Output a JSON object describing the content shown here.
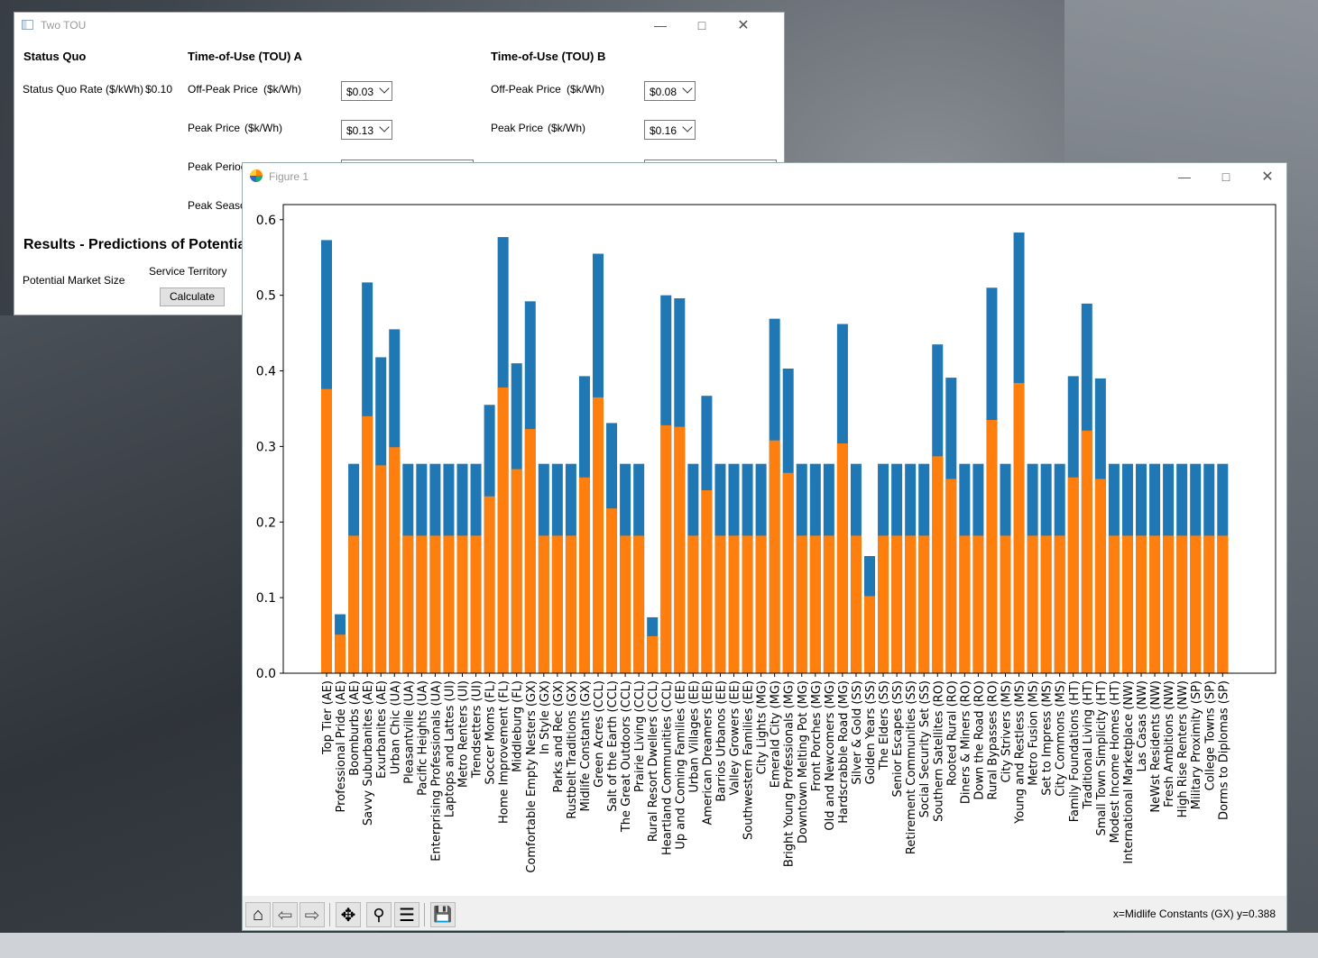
{
  "tou_window": {
    "title": "Two TOU",
    "status_quo_header": "Status Quo",
    "status_quo_rate_label": "Status Quo Rate ($/kWh)",
    "status_quo_rate_value": "$0.10",
    "tou_a_header": "Time-of-Use (TOU) A",
    "tou_b_header": "Time-of-Use (TOU) B",
    "offpeak_label": "Off-Peak Price",
    "peak_label": "Peak Price",
    "unit_label": "($k/Wh)",
    "peak_period_label": "Peak Period",
    "peak_season_label": "Peak Season",
    "tou_a_offpeak": "$0.03",
    "tou_a_peak": "$0.13",
    "tou_b_offpeak": "$0.08",
    "tou_b_peak": "$0.16",
    "results_header": "Results - Predictions of Potential",
    "potential_market_label": "Potential Market Size",
    "service_territory_label": "Service Territory",
    "calculate_button": "Calculate"
  },
  "figure_window": {
    "title": "Figure 1",
    "coord_readout": "x=Midlife Constants (GX) y=0.388",
    "toolbar_icons": [
      "home-icon",
      "back-icon",
      "forward-icon",
      "pan-icon",
      "zoom-icon",
      "configure-icon",
      "save-icon"
    ]
  },
  "colors": {
    "series_total": "#1f77b4",
    "series_part": "#ff7f0e"
  },
  "chart_data": {
    "type": "bar",
    "title": "",
    "xlabel": "",
    "ylabel": "",
    "ylim": [
      0.0,
      0.62
    ],
    "yticks": [
      "0.0",
      "0.1",
      "0.2",
      "0.3",
      "0.4",
      "0.5",
      "0.6"
    ],
    "categories": [
      "Top Tier (AE)",
      "Professional Pride (AE)",
      "Boomburbs (AE)",
      "Savvy Suburbanites (AE)",
      "Exurbanites (AE)",
      "Urban Chic (UA)",
      "Pleasantville (UA)",
      "Pacific Heights (UA)",
      "Enterprising Professionals (UA)",
      "Laptops and Lattes (UI)",
      "Metro Renters (UI)",
      "Trendsetters (UI)",
      "Soccer Moms (FL)",
      "Home Improvement (FL)",
      "Middleburg (FL)",
      "Comfortable Empty Nesters (GX)",
      "In Style (GX)",
      "Parks and Rec (GX)",
      "Rustbelt Traditions (GX)",
      "Midlife Constants (GX)",
      "Green Acres (CCL)",
      "Salt of the Earth (CCL)",
      "The Great Outdoors (CCL)",
      "Prairie Living (CCL)",
      "Rural Resort Dwellers (CCL)",
      "Heartland Communities (CCL)",
      "Up and Coming Families (EE)",
      "Urban Villages (EE)",
      "American Dreamers (EE)",
      "Barrios Urbanos (EE)",
      "Valley Growers (EE)",
      "Southwestern Families (EE)",
      "City Lights (MG)",
      "Emerald City (MG)",
      "Bright Young Professionals (MG)",
      "Downtown Melting Pot (MG)",
      "Front Porches (MG)",
      "Old and Newcomers (MG)",
      "Hardscrabble Road (MG)",
      "Silver & Gold (SS)",
      "Golden Years (SS)",
      "The Elders (SS)",
      "Senior Escapes (SS)",
      "Retirement Communities (SS)",
      "Social Security Set (SS)",
      "Southern Satellites (RO)",
      "Rooted Rural (RO)",
      "Diners & Miners (RO)",
      "Down the Road (RO)",
      "Rural Bypasses (RO)",
      "City Strivers (MS)",
      "Young and Restless (MS)",
      "Metro Fusion (MS)",
      "Set to Impress (MS)",
      "City Commons (MS)",
      "Family Foundations (HT)",
      "Traditional Living (HT)",
      "Small Town Simplicity (HT)",
      "Modest Income Homes (HT)",
      "International Marketplace (NW)",
      "Las Casas (NW)",
      "NeWst Residents (NW)",
      "Fresh Ambitions (NW)",
      "High Rise Renters (NW)",
      "Military Proximity (SP)",
      "College Towns (SP)",
      "Dorms to Diplomas (SP)"
    ],
    "series": [
      {
        "values": [
          0.573,
          0.078,
          0.277,
          0.517,
          0.418,
          0.455,
          0.277,
          0.277,
          0.277,
          0.277,
          0.277,
          0.277,
          0.355,
          0.577,
          0.41,
          0.492,
          0.277,
          0.277,
          0.277,
          0.393,
          0.555,
          0.331,
          0.277,
          0.277,
          0.074,
          0.5,
          0.496,
          0.277,
          0.367,
          0.277,
          0.277,
          0.277,
          0.277,
          0.469,
          0.403,
          0.277,
          0.277,
          0.277,
          0.462,
          0.277,
          0.155,
          0.277,
          0.277,
          0.277,
          0.277,
          0.435,
          0.391,
          0.277,
          0.277,
          0.51,
          0.277,
          0.583,
          0.277,
          0.277,
          0.277,
          0.393,
          0.489,
          0.39,
          0.277,
          0.277,
          0.277,
          0.277,
          0.277,
          0.277,
          0.277,
          0.277,
          0.277
        ]
      },
      {
        "values": [
          0.376,
          0.051,
          0.182,
          0.34,
          0.275,
          0.299,
          0.182,
          0.182,
          0.182,
          0.182,
          0.182,
          0.182,
          0.234,
          0.378,
          0.27,
          0.323,
          0.182,
          0.182,
          0.182,
          0.259,
          0.365,
          0.218,
          0.182,
          0.182,
          0.049,
          0.328,
          0.326,
          0.182,
          0.242,
          0.182,
          0.182,
          0.182,
          0.182,
          0.308,
          0.265,
          0.182,
          0.182,
          0.182,
          0.304,
          0.182,
          0.102,
          0.182,
          0.182,
          0.182,
          0.182,
          0.287,
          0.257,
          0.182,
          0.182,
          0.335,
          0.182,
          0.384,
          0.182,
          0.182,
          0.182,
          0.259,
          0.321,
          0.257,
          0.182,
          0.182,
          0.182,
          0.182,
          0.182,
          0.182,
          0.182,
          0.182,
          0.182
        ]
      }
    ],
    "legend": "none",
    "grid": false
  }
}
